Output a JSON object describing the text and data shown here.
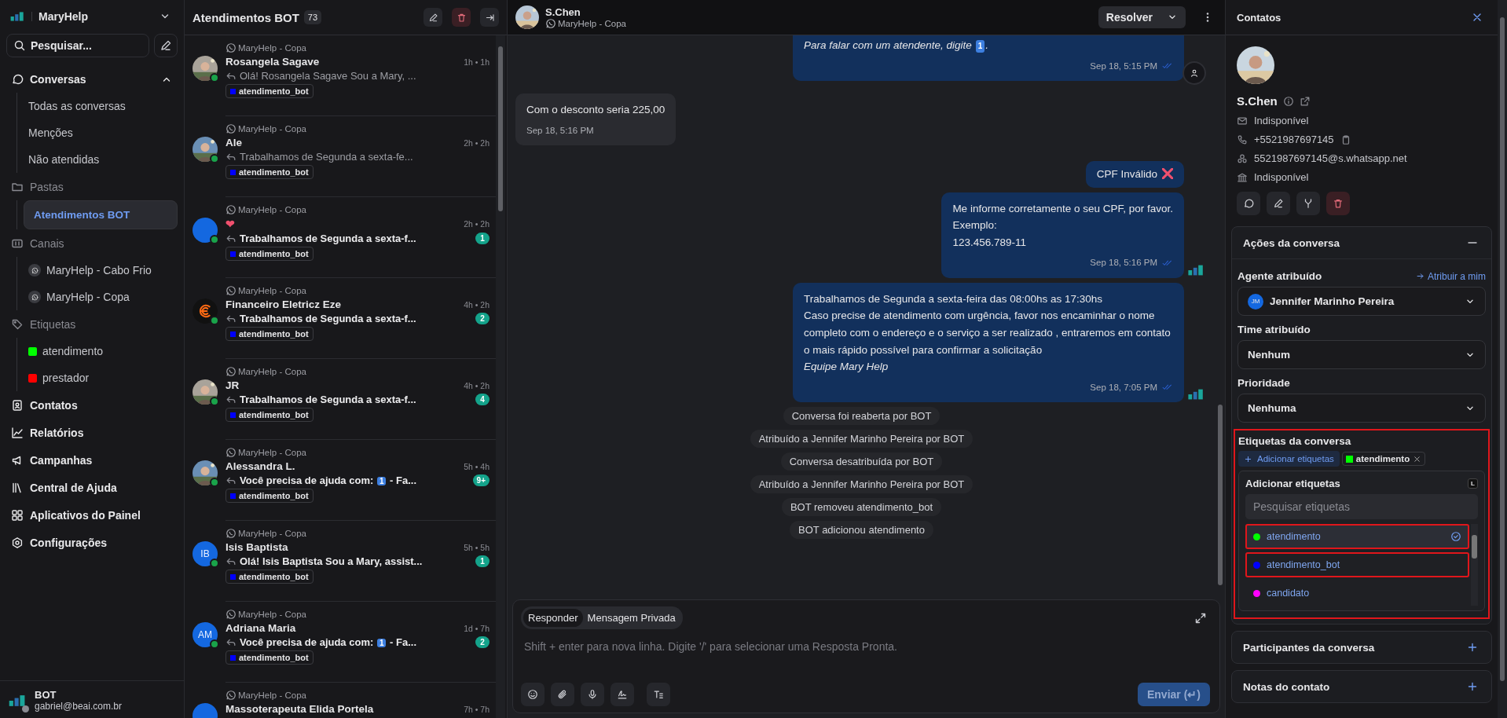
{
  "sidebar": {
    "brand": "MaryHelp",
    "search_label": "Pesquisar...",
    "nav": [
      {
        "label": "Conversas",
        "kind": "group",
        "expanded": true,
        "children": [
          {
            "label": "Todas as conversas",
            "selected": false
          },
          {
            "label": "Menções",
            "selected": false
          },
          {
            "label": "Não atendidas",
            "selected": false
          }
        ]
      },
      {
        "label": "Pastas",
        "kind": "section",
        "children": [
          {
            "label": "Atendimentos BOT",
            "selected": true
          }
        ]
      },
      {
        "label": "Canais",
        "kind": "section",
        "children": [
          {
            "label": "MaryHelp - Cabo Frio",
            "selected": false,
            "kind": "channel"
          },
          {
            "label": "MaryHelp - Copa",
            "selected": false,
            "kind": "channel"
          }
        ]
      },
      {
        "label": "Etiquetas",
        "kind": "section",
        "children": [
          {
            "label": "atendimento",
            "selected": false,
            "kind": "tag",
            "color": "#00ff00"
          },
          {
            "label": "prestador",
            "selected": false,
            "kind": "tag",
            "color": "#ff0000"
          }
        ]
      },
      {
        "label": "Contatos",
        "kind": "link"
      },
      {
        "label": "Relatórios",
        "kind": "link"
      },
      {
        "label": "Campanhas",
        "kind": "link"
      },
      {
        "label": "Central de Ajuda",
        "kind": "link"
      },
      {
        "label": "Aplicativos do Painel",
        "kind": "link"
      },
      {
        "label": "Configurações",
        "kind": "link"
      }
    ],
    "user": {
      "name": "BOT",
      "email": "gabriel@beai.com.br"
    }
  },
  "list": {
    "title": "Atendimentos BOT",
    "count": "73",
    "items": [
      {
        "channel": "MaryHelp - Copa",
        "name": "Rosangela Sagave",
        "time": "1h • 1h",
        "preview": "Olá! Rosangela Sagave Sou a Mary, ...",
        "unread": false,
        "label": {
          "text": "atendimento_bot",
          "color": "#0000ff"
        }
      },
      {
        "channel": "MaryHelp - Copa",
        "name": "Ale",
        "time": "2h • 2h",
        "preview": "Trabalhamos de Segunda a sexta-fe...",
        "unread": false,
        "label": {
          "text": "atendimento_bot",
          "color": "#0000ff"
        }
      },
      {
        "channel": "MaryHelp - Copa",
        "name": "❤",
        "time": "2h • 2h",
        "preview": "Trabalhamos de Segunda a sexta-f...",
        "unread": true,
        "count": "1",
        "avatar": {
          "kind": "plain"
        },
        "label": {
          "text": "atendimento_bot",
          "color": "#0000ff"
        }
      },
      {
        "channel": "MaryHelp - Copa",
        "name": "Financeiro Eletricz Eze",
        "time": "4h • 2h",
        "preview": "Trabalhamos de Segunda a sexta-f...",
        "unread": true,
        "count": "2",
        "avatar": {
          "kind": "logo"
        },
        "label": {
          "text": "atendimento_bot",
          "color": "#0000ff"
        }
      },
      {
        "channel": "MaryHelp - Copa",
        "name": "JR",
        "time": "4h • 2h",
        "preview": "Trabalhamos de Segunda a sexta-f...",
        "unread": true,
        "count": "4",
        "label": {
          "text": "atendimento_bot",
          "color": "#0000ff"
        }
      },
      {
        "channel": "MaryHelp - Copa",
        "name": "Alessandra L.",
        "time": "5h • 4h",
        "preview": "Você precisa de ajuda com: ",
        "keycap": "1",
        "preview_end": " - Fa...",
        "unread": true,
        "count": "9+",
        "label": {
          "text": "atendimento_bot",
          "color": "#0000ff"
        }
      },
      {
        "channel": "MaryHelp - Copa",
        "name": "Isis Baptista",
        "time": "5h • 5h",
        "preview": "Olá! Isis Baptista Sou a Mary, assist...",
        "unread": true,
        "count": "1",
        "avatar": {
          "kind": "initials",
          "initials": "IB"
        },
        "label": {
          "text": "atendimento_bot",
          "color": "#0000ff"
        }
      },
      {
        "channel": "MaryHelp - Copa",
        "name": "Adriana Maria",
        "time": "1d • 7h",
        "preview": "Você precisa de ajuda com: ",
        "keycap": "1",
        "preview_end": " - Fa...",
        "unread": true,
        "count": "2",
        "avatar": {
          "kind": "initials",
          "initials": "AM"
        },
        "label": {
          "text": "atendimento_bot",
          "color": "#0000ff"
        }
      },
      {
        "channel": "MaryHelp - Copa",
        "name": "Massoterapeuta Elida Portela",
        "time": "7h • 7h",
        "avatar": {
          "kind": "plain"
        }
      }
    ]
  },
  "chat": {
    "contact": "S.Chen",
    "channel": "MaryHelp - Copa",
    "resolve": "Resolver",
    "messages": [
      {
        "kind": "outgoing",
        "lines": [
          {
            "text": "Para falar com um atendente, digite ",
            "keycap": "1",
            "after": ".",
            "italic": true
          }
        ],
        "time": "Sep 18, 5:15 PM"
      },
      {
        "kind": "incoming",
        "lines": [
          {
            "text": "Com o desconto seria 225,00"
          }
        ],
        "time": "Sep 18, 5:16 PM"
      },
      {
        "kind": "outgoing",
        "compact": true,
        "lines": [
          {
            "text": "CPF Inválido",
            "cross": true
          }
        ]
      },
      {
        "kind": "outgoing",
        "lines": [
          {
            "text": "Me informe corretamente o seu CPF, por favor."
          },
          {
            "text": "Exemplo:"
          },
          {
            "text": "123.456.789-11"
          }
        ],
        "time": "Sep 18, 5:16 PM"
      },
      {
        "kind": "outgoing",
        "lines": [
          {
            "text": "Trabalhamos de Segunda a sexta-feira das 08:00hs as 17:30hs"
          },
          {
            "text": "Caso precise de atendimento com urgência, favor nos encaminhar o nome completo com o endereço e o serviço a ser realizado , entraremos em contato o mais rápido possível para confirmar a solicitação"
          },
          {
            "text": "Equipe Mary Help",
            "italic": true
          }
        ],
        "time": "Sep 18, 7:05 PM"
      },
      {
        "kind": "activity",
        "text": "Conversa foi reaberta por BOT"
      },
      {
        "kind": "activity",
        "text": "Atribuído a Jennifer Marinho Pereira por BOT"
      },
      {
        "kind": "activity",
        "text": "Conversa desatribuída por BOT"
      },
      {
        "kind": "activity",
        "text": "Atribuído a Jennifer Marinho Pereira por BOT"
      },
      {
        "kind": "activity",
        "text": "BOT removeu atendimento_bot"
      },
      {
        "kind": "activity",
        "text": "BOT adicionou atendimento"
      }
    ],
    "composer": {
      "tabs": [
        {
          "label": "Responder",
          "selected": true
        },
        {
          "label": "Mensagem Privada",
          "selected": false
        }
      ],
      "placeholder": "Shift + enter para nova linha. Digite '/' para selecionar uma Resposta Pronta.",
      "send": "Enviar (↵)",
      "send_disabled": true
    }
  },
  "contact_panel": {
    "title": "Contatos",
    "name": "S.Chen",
    "email": "Indisponível",
    "phone": "+5521987697145",
    "whatsapp": "5521987697145@s.whatsapp.net",
    "company": "Indisponível",
    "actions": {
      "title": "Ações da conversa",
      "expanded": true,
      "agent_label": "Agente atribuído",
      "assign_me": "Atribuir a mim",
      "agent_initials": "JM",
      "agent": "Jennifer Marinho Pereira",
      "team_label": "Time atribuído",
      "team": "Nenhum",
      "priority_label": "Prioridade",
      "priority": "Nenhuma",
      "tags_label": "Etiquetas da conversa",
      "tags_highlighted": true,
      "add_tags": "Adicionar etiquetas",
      "tags": [
        {
          "text": "atendimento",
          "color": "#00ff00"
        }
      ],
      "dropdown": {
        "title": "Adicionar etiquetas",
        "shortcut": "L",
        "placeholder": "Pesquisar etiquetas",
        "options": [
          {
            "label": "atendimento",
            "color": "#00ff00",
            "selected": true,
            "highlighted": true
          },
          {
            "label": "atendimento_bot",
            "color": "#0000ff",
            "selected": false,
            "highlighted": true
          },
          {
            "label": "candidato",
            "color": "#ff00ff",
            "selected": false,
            "highlighted": false
          }
        ]
      }
    },
    "sections": [
      {
        "title": "Participantes da conversa"
      },
      {
        "title": "Notas do contato"
      }
    ]
  }
}
